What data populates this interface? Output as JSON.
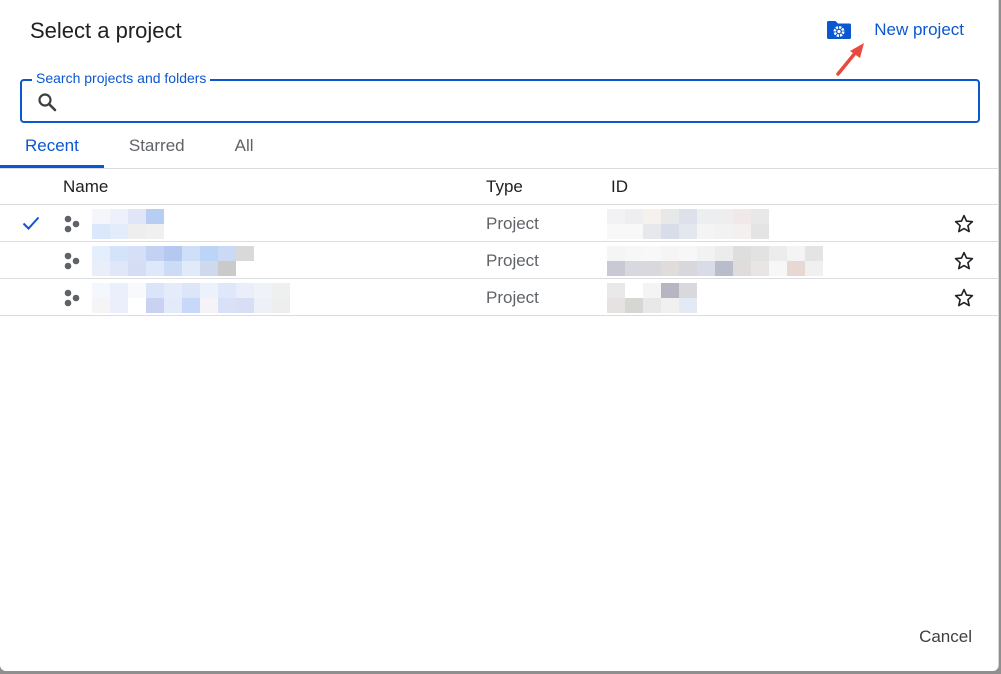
{
  "dialog": {
    "title": "Select a project",
    "new_project_label": "New project",
    "cancel_label": "Cancel",
    "accent_color": "#0b57d0"
  },
  "search": {
    "label": "Search projects and folders",
    "value": "",
    "placeholder": ""
  },
  "tabs": [
    {
      "label": "Recent",
      "active": true
    },
    {
      "label": "Starred",
      "active": false
    },
    {
      "label": "All",
      "active": false
    }
  ],
  "table": {
    "columns": [
      "Name",
      "Type",
      "ID"
    ],
    "rows": [
      {
        "selected": true,
        "type": "Project",
        "starred": false,
        "name_pixels": [
          "#f4f6fc",
          "#eef1fb",
          "#e0e6f8",
          "#b7cdf4",
          "#dbe7fa",
          "#e3ecfa",
          "#eeeeee",
          "#f0f0f0"
        ],
        "id_pixels": [
          "#f2f2f5",
          "#eeeef1",
          "#f6f1ec",
          "#e6e9e8",
          "#dee1ec",
          "#eceef0",
          "#eeeeee",
          "#f1e9e9",
          "#e8e8e8",
          "#f8f8f8",
          "#f8f8f8",
          "#e6e8ec",
          "#d8dee9",
          "#e3e8ef",
          "#f4f4f4",
          "#f2f2f2",
          "#f5f0f0",
          "#e4e4e4"
        ]
      },
      {
        "selected": false,
        "type": "Project",
        "starred": false,
        "name_pixels": [
          "#e4eefd",
          "#d2e3fa",
          "#d5e0f8",
          "#c3d1f3",
          "#b5c8f0",
          "#cfdff8",
          "#bcd4f7",
          "#c9d9f6",
          "#d9d9d9",
          "#eaeef9",
          "#e0e7f8",
          "#d4ddf4",
          "#dde8fa",
          "#ccdcf7",
          "#e1eaf9",
          "#cfd9ee",
          "#cacaca",
          "#ffffff"
        ],
        "id_pixels": [
          "#f5f5f5",
          "#f7f7f7",
          "#f8f8f8",
          "#f5f5f5",
          "#f7f7f7",
          "#f2f2f2",
          "#ececec",
          "#dedede",
          "#e2e2e2",
          "#ececec",
          "#f4f4f4",
          "#e4e4e4",
          "#c9c9d3",
          "#d8d8e0",
          "#d9d9dd",
          "#e0dcdc",
          "#d7d7dc",
          "#d8dce6",
          "#b8bccb",
          "#e1dcdc",
          "#e9e5e5",
          "#f7f7f7",
          "#e8d8d4",
          "#f0f0f0"
        ]
      },
      {
        "selected": false,
        "type": "Project",
        "starred": false,
        "name_pixels": [
          "#f4f7fd",
          "#eaeffc",
          "#f7f9fd",
          "#dbe5fa",
          "#e4ecfb",
          "#dde6f8",
          "#ecf2fc",
          "#dfe8fa",
          "#e9eefa",
          "#eff2f8",
          "#eef0f0",
          "#f5f5f5",
          "#eaeffb",
          "#ffffff",
          "#c9d3f1",
          "#e3eafa",
          "#c8d8f8",
          "#f5f3f8",
          "#d9e1f8",
          "#d8dff4",
          "#eef0f8",
          "#eeeeee"
        ],
        "id_pixels": [
          "#e9e9e9",
          "#ffffff",
          "#f4f4f4",
          "#b7b5c2",
          "#d9d9dd",
          "#e7e2e2",
          "#d6d6d2",
          "#e8e8e8",
          "#f0f0f0",
          "#e4eaf3"
        ]
      }
    ]
  }
}
